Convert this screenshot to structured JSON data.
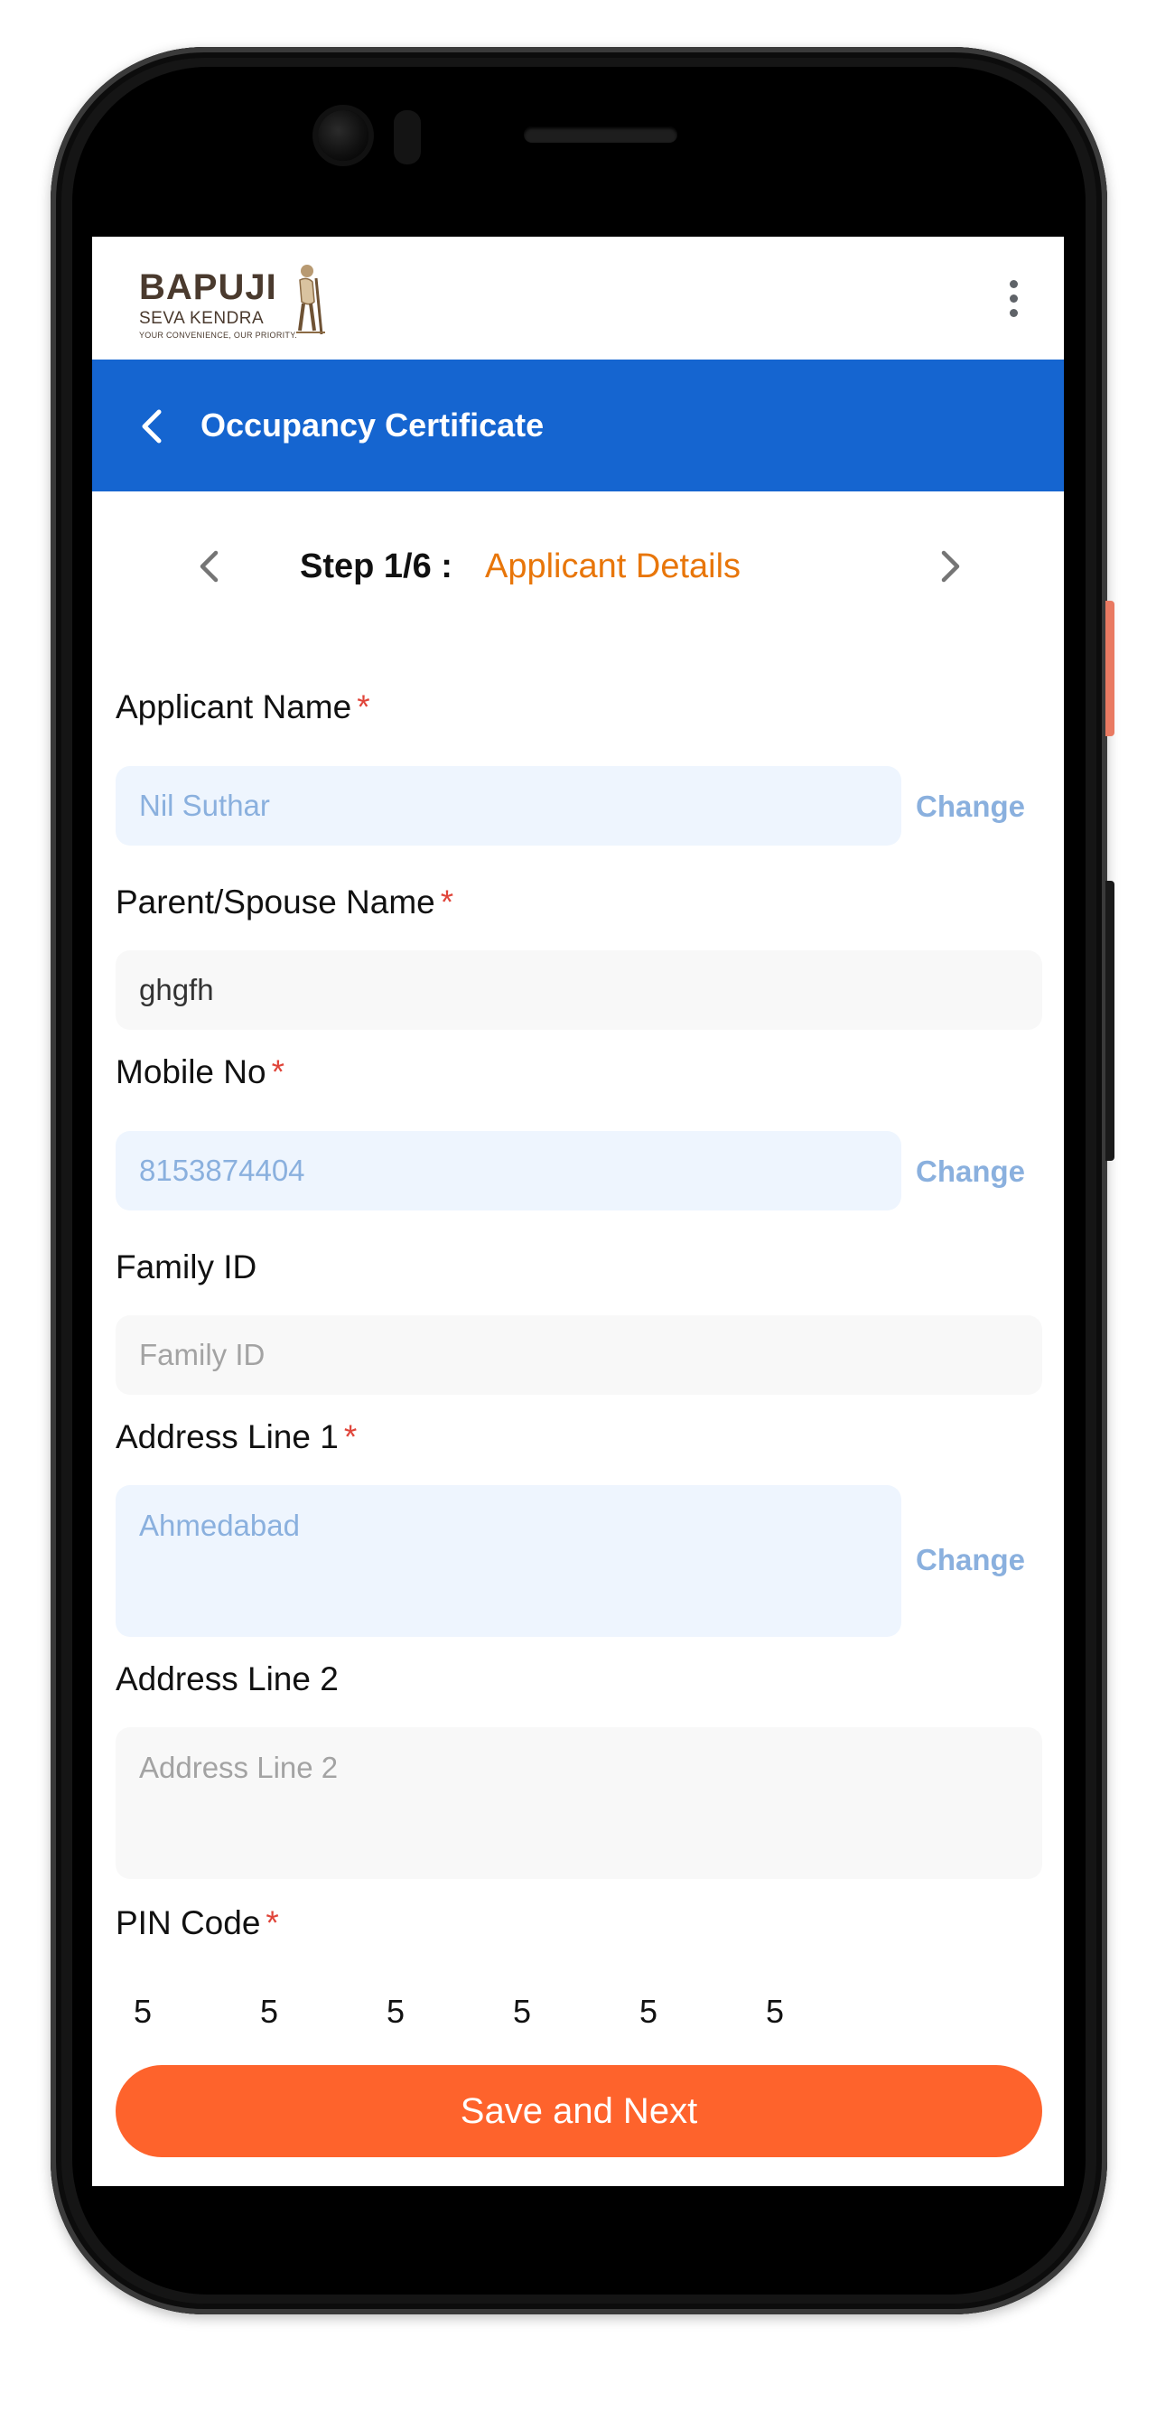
{
  "brand": {
    "name": "BAPUJI",
    "sub": "SEVA KENDRA",
    "tagline": "YOUR CONVENIENCE, OUR PRIORITY."
  },
  "header": {
    "title": "Occupancy Certificate"
  },
  "stepper": {
    "step": "Step 1/6 :",
    "name": "Applicant Details"
  },
  "form": {
    "applicant_name": {
      "label": "Applicant Name",
      "required": "*",
      "value": "Nil Suthar",
      "action": "Change"
    },
    "parent_spouse_name": {
      "label": "Parent/Spouse Name",
      "required": "*",
      "value": "ghgfh"
    },
    "mobile_no": {
      "label": "Mobile No",
      "required": "*",
      "value": "8153874404",
      "action": "Change"
    },
    "family_id": {
      "label": "Family ID",
      "placeholder": "Family ID"
    },
    "address_line_1": {
      "label": "Address Line 1",
      "required": "*",
      "value": "Ahmedabad",
      "action": "Change"
    },
    "address_line_2": {
      "label": "Address Line 2",
      "placeholder": "Address Line 2"
    },
    "pin_code": {
      "label": "PIN Code",
      "required": "*",
      "digits": [
        "5",
        "5",
        "5",
        "5",
        "5",
        "5"
      ]
    }
  },
  "actions": {
    "save_next": "Save and Next"
  },
  "colors": {
    "primary": "#1565d0",
    "accent": "#fe632c",
    "step_name": "#e8760a",
    "required": "#e0453a",
    "locked_bg": "#eef5fe",
    "locked_text": "#8ab0de"
  }
}
